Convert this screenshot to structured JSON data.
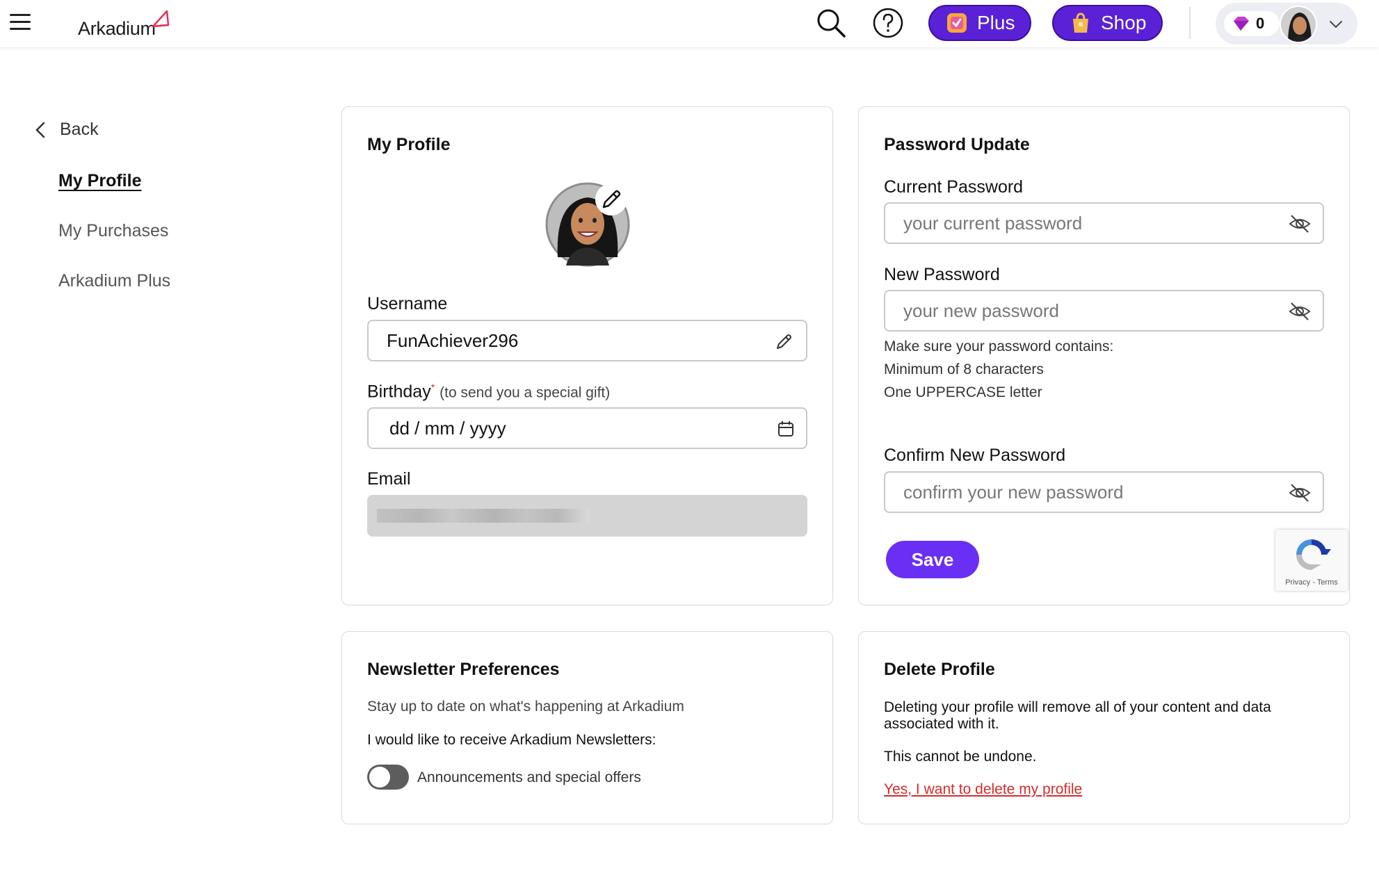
{
  "header": {
    "logo_text": "Arkadium",
    "plus_label": "Plus",
    "shop_label": "Shop",
    "gem_count": "0"
  },
  "nav": {
    "back_label": "Back",
    "items": [
      {
        "label": "My Profile",
        "active": true
      },
      {
        "label": "My Purchases",
        "active": false
      },
      {
        "label": "Arkadium Plus",
        "active": false
      }
    ]
  },
  "profile": {
    "title": "My Profile",
    "username_label": "Username",
    "username_value": "FunAchiever296",
    "birthday_label": "Birthday",
    "birthday_required": "*",
    "birthday_hint": "(to send you a special gift)",
    "birthday_placeholder": "dd / mm / yyyy",
    "email_label": "Email"
  },
  "password": {
    "title": "Password Update",
    "current_label": "Current Password",
    "current_placeholder": "your current password",
    "new_label": "New Password",
    "new_placeholder": "your new password",
    "rules_intro": "Make sure your password contains:",
    "rules": [
      "Minimum of 8 characters",
      "One UPPERCASE letter"
    ],
    "confirm_label": "Confirm New Password",
    "confirm_placeholder": "confirm your new password",
    "save_label": "Save",
    "recaptcha_links": "Privacy - Terms"
  },
  "newsletter": {
    "title": "Newsletter Preferences",
    "subtitle": "Stay up to date on what's happening at Arkadium",
    "prompt": "I would like to receive Arkadium Newsletters:",
    "toggle_label": "Announcements and special offers",
    "toggle_on": false
  },
  "delete": {
    "title": "Delete Profile",
    "description": "Deleting your profile will remove all of your content and data associated with it.",
    "warning": "This cannot be undone.",
    "link_label": "Yes, I want to delete my profile"
  },
  "colors": {
    "accent": "#6a2ff5",
    "pill": "#5b21d6",
    "danger": "#d62b2b",
    "brand_mark": "#e8305a"
  }
}
